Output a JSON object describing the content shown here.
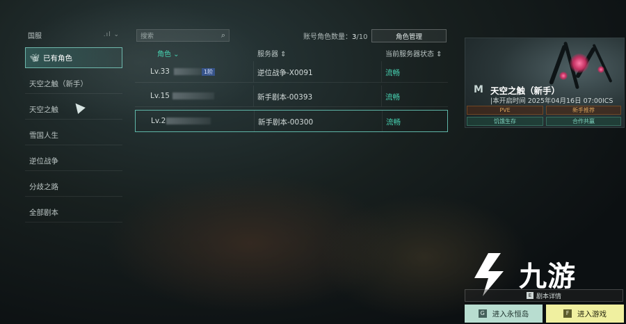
{
  "sidebar": {
    "region": "国服",
    "items": [
      {
        "label": "已有角色",
        "active": true
      },
      {
        "label": "天空之触（新手）"
      },
      {
        "label": "天空之触"
      },
      {
        "label": "雪国人生"
      },
      {
        "label": "逆位战争"
      },
      {
        "label": "分歧之路"
      },
      {
        "label": "全部剧本"
      }
    ]
  },
  "toolbar": {
    "search_placeholder": "搜索",
    "count_label": "账号角色数量：",
    "count_value": "3",
    "count_max": "/10",
    "manage_label": "角色管理"
  },
  "table": {
    "headers": {
      "role": "角色",
      "server": "服务器",
      "status": "当前服务器状态"
    },
    "rows": [
      {
        "level": "Lv.33",
        "tag": "1阶",
        "server": "逆位战争-X0091",
        "status": "流畅"
      },
      {
        "level": "Lv.15",
        "server": "新手剧本-00393",
        "status": "流畅"
      },
      {
        "level": "Lv.2",
        "server": "新手剧本-00300",
        "status": "流畅",
        "selected": true
      }
    ]
  },
  "card": {
    "title": "天空之触（新手）",
    "time": "|本开启时间 2025年04月16日 07:00ICS",
    "tags": [
      "PVE",
      "新手推荐",
      "饥饿生存",
      "合作共赢"
    ]
  },
  "actions": {
    "detail_key": "E",
    "detail_label": "剧本详情",
    "island_key": "G",
    "island_label": "进入永恒岛",
    "play_key": "F",
    "play_label": "进入游戏"
  },
  "watermark": {
    "text": "九游"
  },
  "colors": {
    "accent": "#47d0b0",
    "play_button": "#f0f0a0",
    "island_button": "#b8ddd0"
  }
}
